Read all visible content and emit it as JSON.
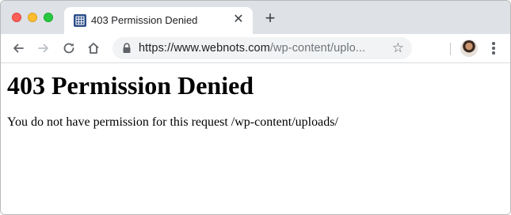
{
  "window": {
    "controls": [
      "close",
      "minimize",
      "zoom"
    ]
  },
  "tab": {
    "title": "403 Permission Denied",
    "favicon_icon": "grid-favicon-icon",
    "close_glyph": "✕"
  },
  "new_tab": {
    "glyph": "+"
  },
  "toolbar": {
    "back_icon": "arrow-left-icon",
    "forward_icon": "arrow-right-icon",
    "reload_icon": "reload-icon",
    "home_icon": "home-icon"
  },
  "address_bar": {
    "url_host": "https://www.webnots.com",
    "url_rest": "/wp-content/uplo...",
    "lock_icon": "lock-icon",
    "bookmark_glyph": "☆"
  },
  "page": {
    "heading": "403 Permission Denied",
    "message": "You do not have permission for this request /wp-content/uploads/"
  },
  "colors": {
    "tabstrip": "#dee1e6",
    "omnibox": "#f1f3f4",
    "close": "#fe5f57",
    "minimize": "#febc2e",
    "zoom": "#28c840"
  }
}
